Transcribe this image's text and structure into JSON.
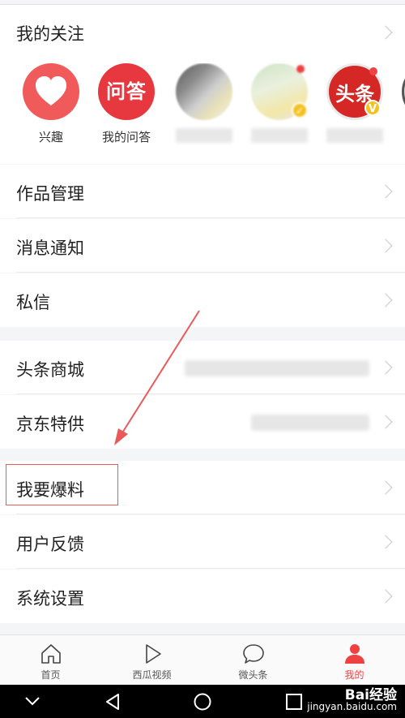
{
  "follow": {
    "title": "我的关注",
    "items": [
      {
        "label": "兴趣",
        "icon": "heart-icon"
      },
      {
        "label": "我的问答",
        "badge_text": "问答"
      },
      {
        "label": ""
      },
      {
        "label": ""
      },
      {
        "label": "",
        "badge_text": "头条",
        "verified": "V"
      }
    ]
  },
  "menu": {
    "works": "作品管理",
    "notifications": "消息通知",
    "messages": "私信",
    "mall": "头条商城",
    "jd": "京东特供",
    "report": "我要爆料",
    "feedback": "用户反馈",
    "settings": "系统设置"
  },
  "tabs": [
    {
      "label": "首页",
      "icon": "home-icon"
    },
    {
      "label": "西瓜视频",
      "icon": "play-icon"
    },
    {
      "label": "微头条",
      "icon": "chat-bubble-icon"
    },
    {
      "label": "我的",
      "icon": "person-icon"
    }
  ],
  "watermark": {
    "brand": "Bai经验",
    "url": "jingyan.baidu.com"
  },
  "colors": {
    "accent": "#f04142",
    "annotation": "#e85a5a"
  }
}
